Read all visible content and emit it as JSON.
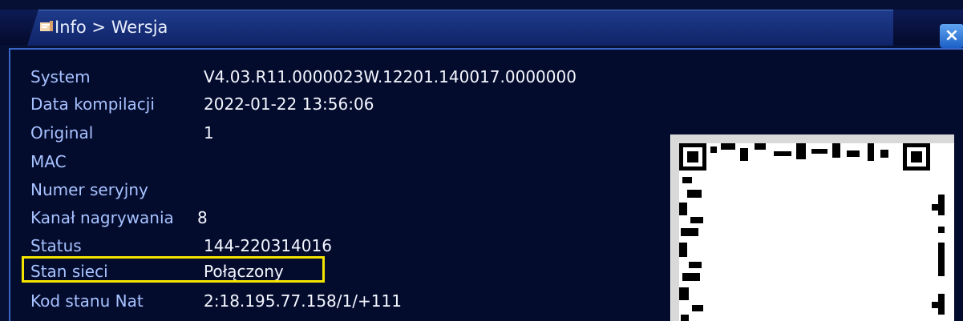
{
  "window": {
    "title": "Info > Wersja",
    "close_icon": "close-icon"
  },
  "info": {
    "rows": [
      {
        "label": "System",
        "value": "V4.03.R11.0000023W.12201.140017.0000000"
      },
      {
        "label": "Data kompilacji",
        "value": "2022-01-22 13:56:06"
      },
      {
        "label": "Original",
        "value": "1"
      },
      {
        "label": "MAC",
        "value": ""
      },
      {
        "label": "Numer seryjny",
        "value": ""
      },
      {
        "label": "Kanał nagrywania",
        "value": "8"
      },
      {
        "label": "Status",
        "value": "144-220314016"
      },
      {
        "label": "Stan sieci",
        "value": "Połączony"
      },
      {
        "label": "Kod stanu Nat",
        "value": "2:18.195.77.158/1/+111"
      }
    ]
  },
  "qr_code": {
    "icon": "qr-code-icon"
  },
  "colors": {
    "background": "#061034",
    "panel_border": "#3a66c8",
    "highlight": "#f4e400",
    "close_button": "#2f7be0"
  }
}
